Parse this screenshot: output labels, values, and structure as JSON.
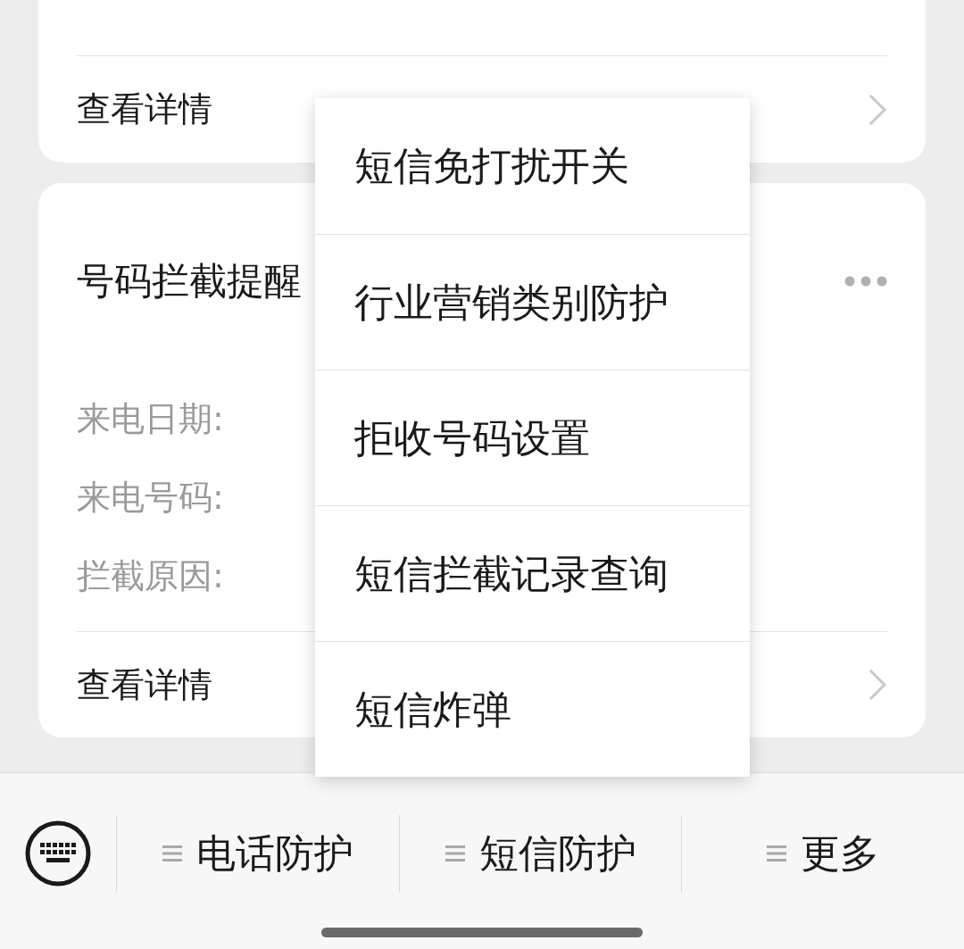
{
  "top_card": {
    "link": "查看详情"
  },
  "block_card": {
    "title": "号码拦截提醒",
    "fields": [
      "来电日期:",
      "来电号码:",
      "拦截原因:"
    ],
    "link": "查看详情"
  },
  "popup_menu": {
    "items": [
      "短信免打扰开关",
      "行业营销类别防护",
      "拒收号码设置",
      "短信拦截记录查询",
      "短信炸弹"
    ]
  },
  "bottom_bar": {
    "tabs": [
      {
        "label": "电话防护"
      },
      {
        "label": "短信防护"
      },
      {
        "label": "更多"
      }
    ]
  }
}
